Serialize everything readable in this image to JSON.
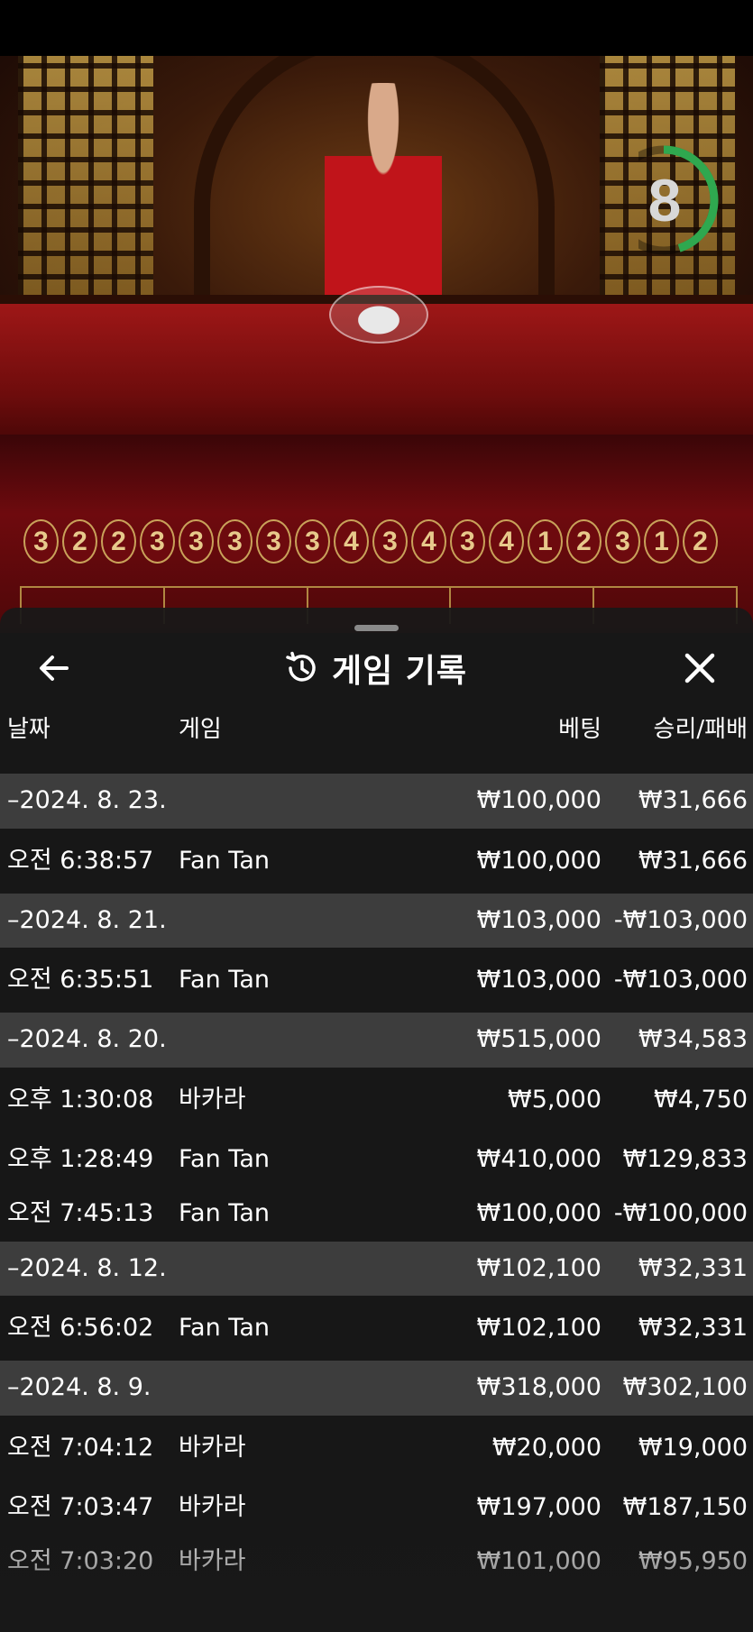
{
  "game": {
    "countdown": "8",
    "countdown_fraction": 0.45,
    "history_results": [
      "3",
      "2",
      "2",
      "3",
      "3",
      "3",
      "3",
      "3",
      "4",
      "3",
      "4",
      "3",
      "4",
      "1",
      "2",
      "3",
      "1",
      "2"
    ]
  },
  "sheet": {
    "title": "게임 기록",
    "back_icon": "arrow-left-icon",
    "history_icon": "history-icon",
    "close_icon": "close-icon",
    "columns": {
      "date": "날짜",
      "game": "게임",
      "bet": "베팅",
      "win_loss": "승리/패배"
    },
    "groups": [
      {
        "date": "–2024. 8. 23.",
        "bet": "₩100,000",
        "win_loss": "₩31,666",
        "items": [
          {
            "time": "오전 6:38:57",
            "game": "Fan Tan",
            "bet": "₩100,000",
            "win_loss": "₩31,666"
          }
        ]
      },
      {
        "date": "–2024. 8. 21.",
        "bet": "₩103,000",
        "win_loss": "-₩103,000",
        "items": [
          {
            "time": "오전 6:35:51",
            "game": "Fan Tan",
            "bet": "₩103,000",
            "win_loss": "-₩103,000"
          }
        ]
      },
      {
        "date": "–2024. 8. 20.",
        "bet": "₩515,000",
        "win_loss": "₩34,583",
        "items": [
          {
            "time": "오후 1:30:08",
            "game": "바카라",
            "bet": "₩5,000",
            "win_loss": "₩4,750"
          },
          {
            "time": "오후 1:28:49",
            "game": "Fan Tan",
            "bet": "₩410,000",
            "win_loss": "₩129,833"
          },
          {
            "time": "오전 7:45:13",
            "game": "Fan Tan",
            "bet": "₩100,000",
            "win_loss": "-₩100,000"
          }
        ]
      },
      {
        "date": "–2024. 8. 12.",
        "bet": "₩102,100",
        "win_loss": "₩32,331",
        "items": [
          {
            "time": "오전 6:56:02",
            "game": "Fan Tan",
            "bet": "₩102,100",
            "win_loss": "₩32,331"
          }
        ]
      },
      {
        "date": "–2024. 8. 9.",
        "bet": "₩318,000",
        "win_loss": "₩302,100",
        "items": [
          {
            "time": "오전 7:04:12",
            "game": "바카라",
            "bet": "₩20,000",
            "win_loss": "₩19,000"
          },
          {
            "time": "오전 7:03:47",
            "game": "바카라",
            "bet": "₩197,000",
            "win_loss": "₩187,150"
          },
          {
            "time": "오전 7:03:20",
            "game": "바카라",
            "bet": "₩101,000",
            "win_loss": "₩95,950"
          }
        ]
      }
    ]
  },
  "colors": {
    "group_row": "#3d3d3d",
    "sheet_bg": "#181818",
    "timer_ring": "#2fa84f",
    "felt": "#8f1414",
    "gold": "#c9a25a"
  }
}
